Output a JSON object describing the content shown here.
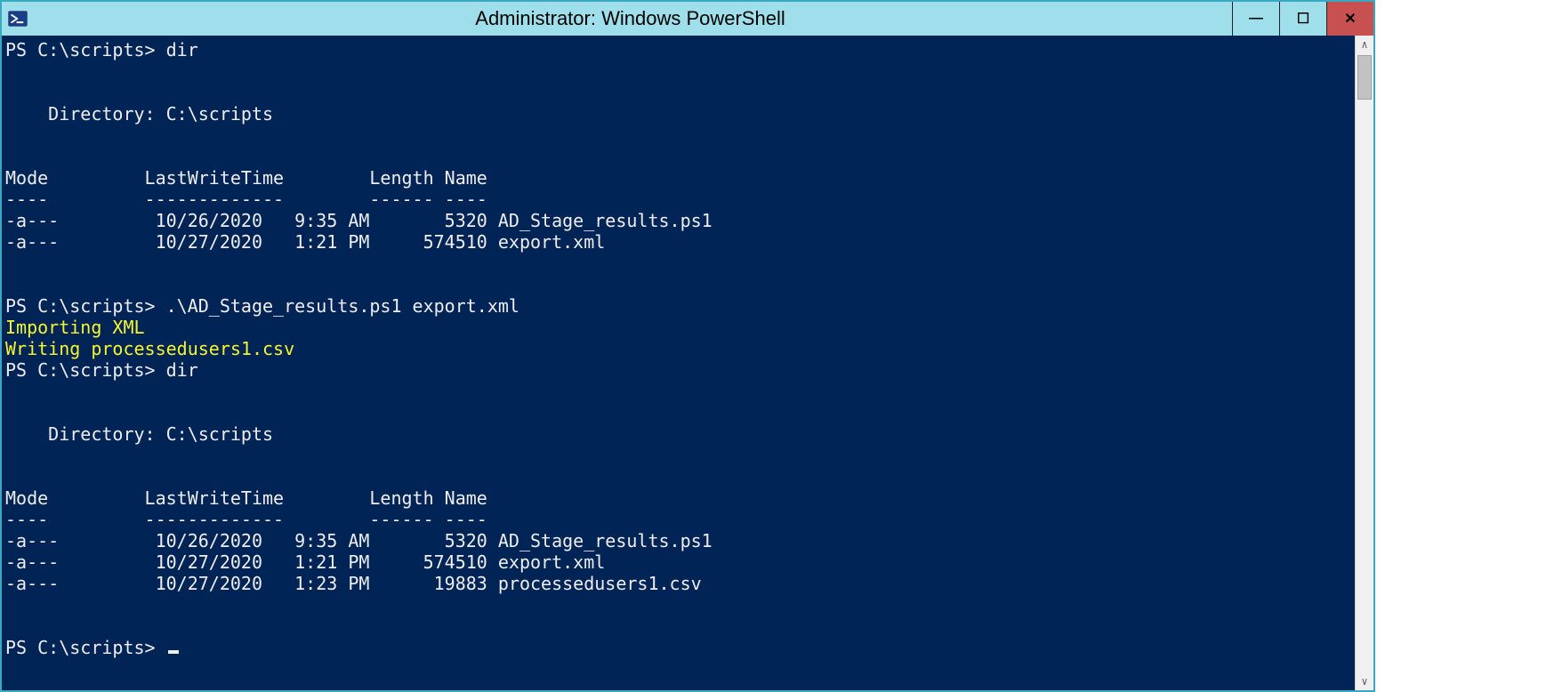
{
  "window": {
    "title": "Administrator: Windows PowerShell"
  },
  "caption": {
    "minimize_glyph": "—",
    "maximize_glyph": "☐",
    "close_glyph": "✕"
  },
  "term": {
    "prompt": "PS C:\\scripts>",
    "safe_prompt": "PS C:\\scripts>",
    "cmd1": "dir",
    "dir1_header": "    Directory: C:\\scripts",
    "cols_mode": "Mode",
    "cols_last": "LastWriteTime",
    "cols_len": "Length",
    "cols_name": "Name",
    "rule_mode": "----",
    "rule_last": "-------------",
    "rule_len": "------",
    "rule_name": "----",
    "files1": [
      {
        "mode": "-a---",
        "date": "10/26/2020",
        "time": "9:35 AM",
        "len": "5320",
        "name": "AD_Stage_results.ps1"
      },
      {
        "mode": "-a---",
        "date": "10/27/2020",
        "time": "1:21 PM",
        "len": "574510",
        "name": "export.xml"
      }
    ],
    "cmd2": ".\\AD_Stage_results.ps1 export.xml",
    "out_yellow1": "Importing XML",
    "out_yellow2": "Writing processedusers1.csv",
    "cmd3": "dir",
    "dir2_header": "    Directory: C:\\scripts",
    "files2": [
      {
        "mode": "-a---",
        "date": "10/26/2020",
        "time": "9:35 AM",
        "len": "5320",
        "name": "AD_Stage_results.ps1"
      },
      {
        "mode": "-a---",
        "date": "10/27/2020",
        "time": "1:21 PM",
        "len": "574510",
        "name": "export.xml"
      },
      {
        "mode": "-a---",
        "date": "10/27/2020",
        "time": "1:23 PM",
        "len": "19883",
        "name": "processedusers1.csv"
      }
    ]
  },
  "scrollbar": {
    "up": "∧",
    "down": "∨"
  }
}
